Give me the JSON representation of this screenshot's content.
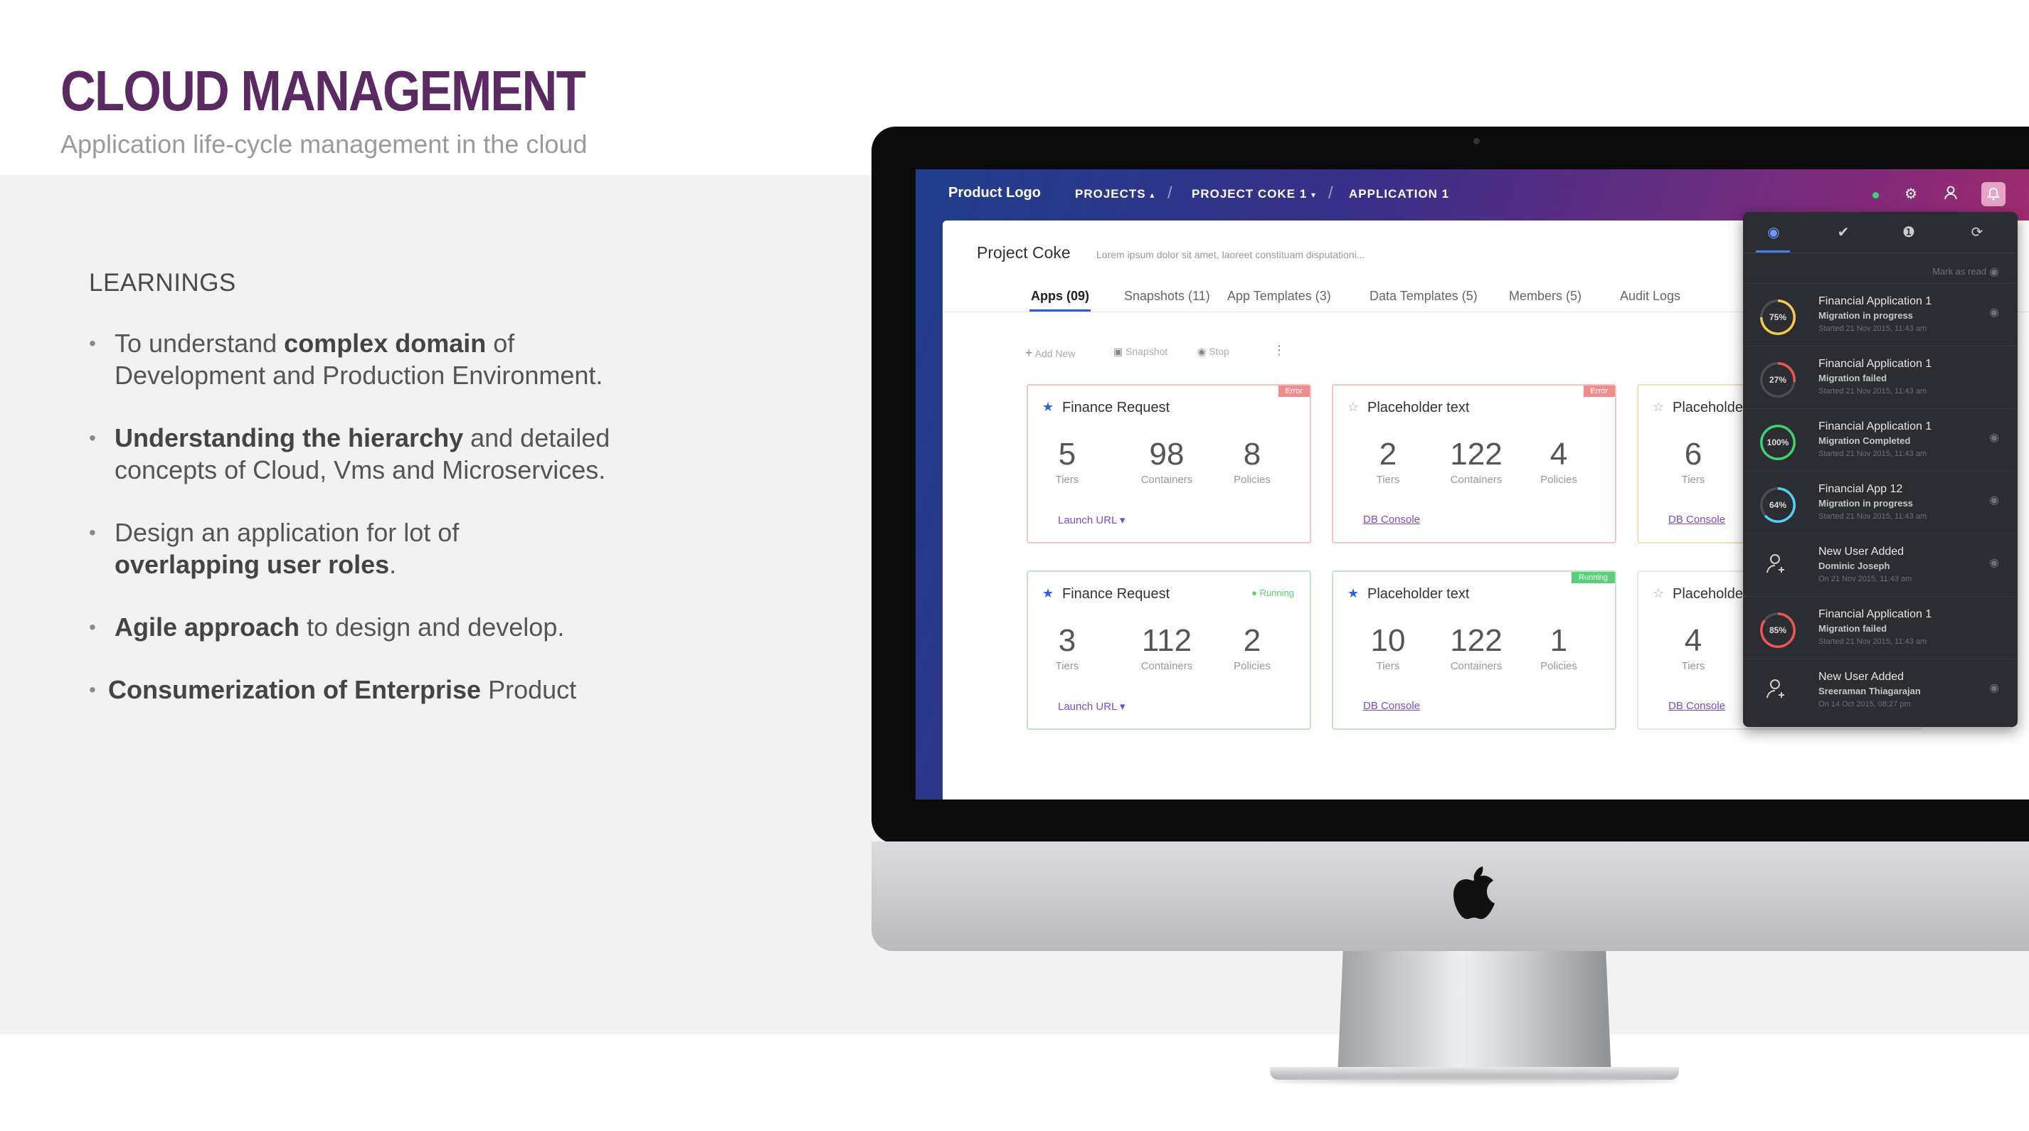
{
  "slide": {
    "title": "CLOUD MANAGEMENT",
    "subtitle": "Application life-cycle management in the cloud",
    "learnings_heading": "LEARNINGS",
    "bullets": [
      {
        "pre": "To understand ",
        "bold": "complex domain",
        "post": " of",
        "line2": "Development and Production Environment."
      },
      {
        "pre": "",
        "bold": "Understanding the hierarchy",
        "post": " and detailed",
        "line2": "concepts of Cloud, Vms and Microservices."
      },
      {
        "pre": "Design an application for lot of",
        "bold": "overlapping user roles",
        "post": "."
      },
      {
        "bold": "Agile approach",
        "post": " to design and develop."
      },
      {
        "bold": "Consumerization of Enterprise",
        "post": " Product"
      }
    ],
    "colors": {
      "title": "#5b2a63",
      "subtitle": "#9a9a9a",
      "band": "#f2f2f2"
    }
  },
  "app": {
    "product_logo": "Product Logo",
    "breadcrumbs": [
      "PROJECTS",
      "PROJECT COKE 1",
      "APPLICATION 1"
    ],
    "project_title": "Project Coke",
    "project_desc": "Lorem ipsum dolor sit amet, laoreet constituam disputationi...",
    "tabs": [
      "Apps (09)",
      "Snapshots (11)",
      "App Templates (3)",
      "Data Templates (5)",
      "Members (5)",
      "Audit Logs"
    ],
    "toolbar": {
      "add": "Add New",
      "snapshot": "Snapshot",
      "stop": "Stop"
    },
    "cards": [
      {
        "name": "Finance Request",
        "badge": "Error",
        "tiers": "5",
        "containers": "98",
        "policies": "8",
        "link": "Launch URL"
      },
      {
        "name": "Placeholder text",
        "badge": "Error",
        "tiers": "2",
        "containers": "122",
        "policies": "4",
        "link": "DB Console"
      },
      {
        "name": "Placeholder text",
        "tiers": "6",
        "link": "DB Console"
      },
      {
        "name": "Finance Request",
        "badge": "Running",
        "tiers": "3",
        "containers": "112",
        "policies": "2",
        "link": "Launch URL"
      },
      {
        "name": "Placeholder text",
        "badge": "Running",
        "tiers": "10",
        "containers": "122",
        "policies": "1",
        "link": "DB Console"
      },
      {
        "name": "Placeholder text",
        "tiers": "4",
        "link": "DB Console"
      }
    ],
    "labels": {
      "tiers": "Tiers",
      "containers": "Containers",
      "policies": "Policies"
    },
    "notifications": {
      "mark_read": "Mark as read",
      "items": [
        {
          "title": "Financial Application 1",
          "status": "Migration in progress",
          "time": "Started 21 Nov 2015, 11:43 am",
          "ring": "75%",
          "color": "#f2c94c"
        },
        {
          "title": "Financial Application 1",
          "status": "Migration failed",
          "time": "Started 21 Nov 2015, 11:43 am",
          "ring": "27%",
          "color": "#eb5757"
        },
        {
          "title": "Financial Application 1",
          "status": "Migration Completed",
          "time": "Started 21 Nov 2015, 11:43 am",
          "ring": "100%",
          "color": "#3ecf6e"
        },
        {
          "title": "Financial App 12",
          "status": "Migration in progress",
          "time": "Started 21 Nov 2015, 11:43 am",
          "ring": "64%",
          "color": "#56ccf2"
        },
        {
          "title": "New User Added",
          "status": "Dominic Joseph",
          "time": "On 21 Nov 2015, 11:43 am"
        },
        {
          "title": "Financial Application 1",
          "status": "Migration failed",
          "time": "Started 21 Nov 2015, 11:43 am",
          "ring": "85%",
          "color": "#eb5757"
        },
        {
          "title": "New User Added",
          "status": "Sreeraman Thiagarajan",
          "time": "On 14 Oct 2015, 08:27 pm"
        }
      ]
    }
  }
}
